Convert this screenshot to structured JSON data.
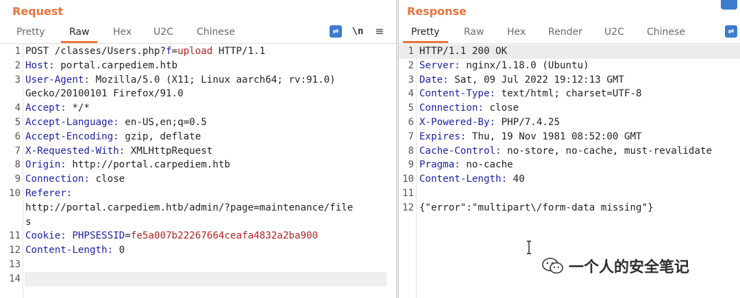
{
  "request": {
    "title": "Request",
    "tabs": [
      "Pretty",
      "Raw",
      "Hex",
      "U2C",
      "Chinese"
    ],
    "active_tab": "Raw",
    "icons": [
      "wrap-icon",
      "newline-icon",
      "menu-icon"
    ],
    "newline_label": "\\n",
    "menu_label": "≡",
    "wrap_label": "⇌",
    "lines": [
      {
        "n": "1",
        "parts": [
          {
            "t": "POST /classes/Users.php?",
            "c": "val"
          },
          {
            "t": "f",
            "c": "hdr"
          },
          {
            "t": "=",
            "c": "val"
          },
          {
            "t": "upload",
            "c": "red"
          },
          {
            "t": " HTTP/1.1",
            "c": "val"
          }
        ]
      },
      {
        "n": "2",
        "parts": [
          {
            "t": "Host:",
            "c": "hdr"
          },
          {
            "t": " portal.carpediem.htb",
            "c": "val"
          }
        ]
      },
      {
        "n": "3",
        "parts": [
          {
            "t": "User-Agent:",
            "c": "hdr"
          },
          {
            "t": " Mozilla/5.0 (X11; Linux aarch64; rv:91.0)",
            "c": "val"
          }
        ]
      },
      {
        "n": "",
        "parts": [
          {
            "t": "Gecko/20100101 Firefox/91.0",
            "c": "val"
          }
        ]
      },
      {
        "n": "4",
        "parts": [
          {
            "t": "Accept:",
            "c": "hdr"
          },
          {
            "t": " */*",
            "c": "val"
          }
        ]
      },
      {
        "n": "5",
        "parts": [
          {
            "t": "Accept-Language:",
            "c": "hdr"
          },
          {
            "t": " en-US,en;q=0.5",
            "c": "val"
          }
        ]
      },
      {
        "n": "6",
        "parts": [
          {
            "t": "Accept-Encoding:",
            "c": "hdr"
          },
          {
            "t": " gzip, deflate",
            "c": "val"
          }
        ]
      },
      {
        "n": "7",
        "parts": [
          {
            "t": "X-Requested-With:",
            "c": "hdr"
          },
          {
            "t": " XMLHttpRequest",
            "c": "val"
          }
        ]
      },
      {
        "n": "8",
        "parts": [
          {
            "t": "Origin:",
            "c": "hdr"
          },
          {
            "t": " http://portal.carpediem.htb",
            "c": "val"
          }
        ]
      },
      {
        "n": "9",
        "parts": [
          {
            "t": "Connection:",
            "c": "hdr"
          },
          {
            "t": " close",
            "c": "val"
          }
        ]
      },
      {
        "n": "10",
        "parts": [
          {
            "t": "Referer:",
            "c": "hdr"
          }
        ]
      },
      {
        "n": "",
        "parts": [
          {
            "t": "http://portal.carpediem.htb/admin/?page=maintenance/file",
            "c": "val"
          }
        ]
      },
      {
        "n": "",
        "parts": [
          {
            "t": "s",
            "c": "val"
          }
        ]
      },
      {
        "n": "11",
        "parts": [
          {
            "t": "Cookie:",
            "c": "hdr"
          },
          {
            "t": " ",
            "c": "val"
          },
          {
            "t": "PHPSESSID",
            "c": "hdr"
          },
          {
            "t": "=",
            "c": "val"
          },
          {
            "t": "fe5a007b22267664ceafa4832a2ba900",
            "c": "red"
          }
        ]
      },
      {
        "n": "12",
        "parts": [
          {
            "t": "Content-Length:",
            "c": "hdr"
          },
          {
            "t": " 0",
            "c": "val"
          }
        ]
      },
      {
        "n": "13",
        "parts": []
      },
      {
        "n": "14",
        "parts": []
      }
    ]
  },
  "response": {
    "title": "Response",
    "tabs": [
      "Pretty",
      "Raw",
      "Hex",
      "Render",
      "U2C",
      "Chinese"
    ],
    "active_tab": "Pretty",
    "wrap_label": "⇌",
    "lines": [
      {
        "n": "1",
        "parts": [
          {
            "t": "HTTP/1.1 200 OK",
            "c": "val"
          }
        ]
      },
      {
        "n": "2",
        "parts": [
          {
            "t": "Server:",
            "c": "hdr"
          },
          {
            "t": " nginx/1.18.0 (Ubuntu)",
            "c": "val"
          }
        ]
      },
      {
        "n": "3",
        "parts": [
          {
            "t": "Date:",
            "c": "hdr"
          },
          {
            "t": " Sat, 09 Jul 2022 19:12:13 GMT",
            "c": "val"
          }
        ]
      },
      {
        "n": "4",
        "parts": [
          {
            "t": "Content-Type:",
            "c": "hdr"
          },
          {
            "t": " text/html; charset=UTF-8",
            "c": "val"
          }
        ]
      },
      {
        "n": "5",
        "parts": [
          {
            "t": "Connection:",
            "c": "hdr"
          },
          {
            "t": " close",
            "c": "val"
          }
        ]
      },
      {
        "n": "6",
        "parts": [
          {
            "t": "X-Powered-By:",
            "c": "hdr"
          },
          {
            "t": " PHP/7.4.25",
            "c": "val"
          }
        ]
      },
      {
        "n": "7",
        "parts": [
          {
            "t": "Expires:",
            "c": "hdr"
          },
          {
            "t": " Thu, 19 Nov 1981 08:52:00 GMT",
            "c": "val"
          }
        ]
      },
      {
        "n": "8",
        "parts": [
          {
            "t": "Cache-Control:",
            "c": "hdr"
          },
          {
            "t": " no-store, no-cache, must-revalidate",
            "c": "val"
          }
        ]
      },
      {
        "n": "9",
        "parts": [
          {
            "t": "Pragma:",
            "c": "hdr"
          },
          {
            "t": " no-cache",
            "c": "val"
          }
        ]
      },
      {
        "n": "10",
        "parts": [
          {
            "t": "Content-Length:",
            "c": "hdr"
          },
          {
            "t": " 40",
            "c": "val"
          }
        ]
      },
      {
        "n": "11",
        "parts": []
      },
      {
        "n": "12",
        "parts": [
          {
            "t": "{\"error\":\"multipart\\/form-data missing\"}",
            "c": "val"
          }
        ]
      }
    ]
  },
  "watermark": {
    "text": "一个人的安全笔记",
    "icon": "wechat-icon"
  }
}
